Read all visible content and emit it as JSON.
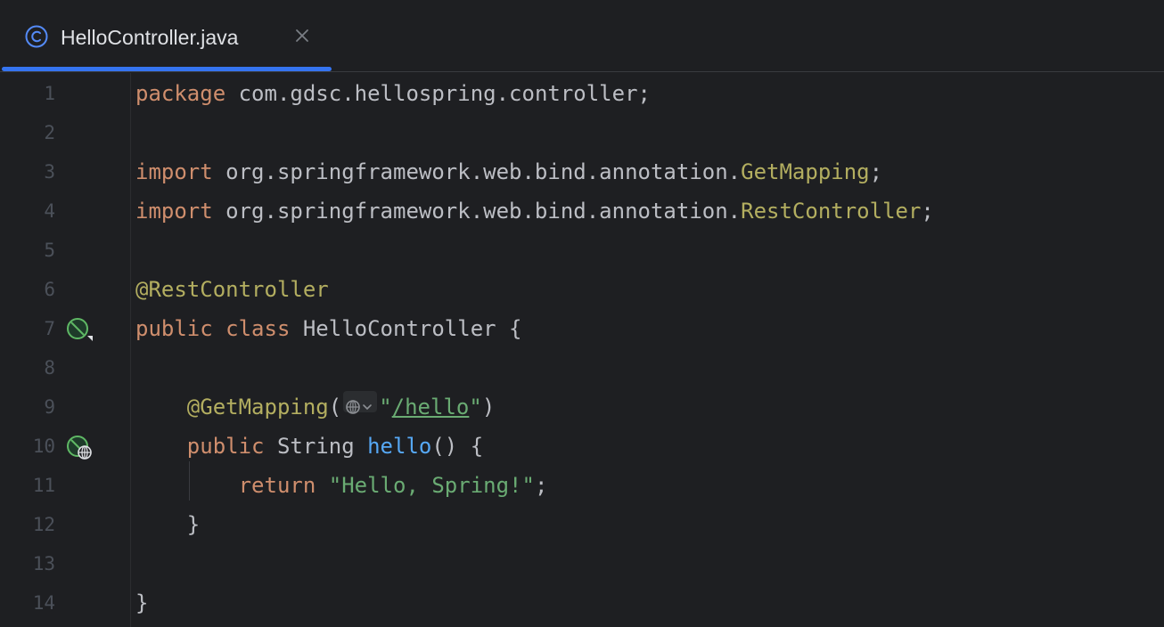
{
  "tab": {
    "title": "HelloController.java",
    "icon": "java-class-icon",
    "close_icon": "close-icon",
    "accent": "#3574f0"
  },
  "editor": {
    "lines": [
      {
        "num": "1",
        "tokens": [
          {
            "t": "package",
            "c": "kw"
          },
          {
            "t": " com.gdsc.hellospring.controller;",
            "c": "plain"
          }
        ]
      },
      {
        "num": "2",
        "tokens": []
      },
      {
        "num": "3",
        "tokens": [
          {
            "t": "import",
            "c": "kw"
          },
          {
            "t": " org.springframework.web.bind.annotation.",
            "c": "plain"
          },
          {
            "t": "GetMapping",
            "c": "ann"
          },
          {
            "t": ";",
            "c": "plain"
          }
        ]
      },
      {
        "num": "4",
        "tokens": [
          {
            "t": "import",
            "c": "kw"
          },
          {
            "t": " org.springframework.web.bind.annotation.",
            "c": "plain"
          },
          {
            "t": "RestController",
            "c": "ann"
          },
          {
            "t": ";",
            "c": "plain"
          }
        ]
      },
      {
        "num": "5",
        "tokens": []
      },
      {
        "num": "6",
        "tokens": [
          {
            "t": "@RestController",
            "c": "ann"
          }
        ]
      },
      {
        "num": "7",
        "tokens": [
          {
            "t": "public",
            "c": "kw"
          },
          {
            "t": " ",
            "c": "plain"
          },
          {
            "t": "class",
            "c": "kw"
          },
          {
            "t": " HelloController {",
            "c": "plain"
          }
        ],
        "gutter_icon": "spring-bean-icon"
      },
      {
        "num": "8",
        "tokens": []
      },
      {
        "num": "9",
        "tokens": [
          {
            "t": "    ",
            "c": "plain"
          },
          {
            "t": "@GetMapping",
            "c": "ann"
          },
          {
            "t": "(",
            "c": "plain"
          },
          {
            "t": "",
            "c": "inlay"
          },
          {
            "t": "\"",
            "c": "str"
          },
          {
            "t": "/hello",
            "c": "url"
          },
          {
            "t": "\"",
            "c": "str"
          },
          {
            "t": ")",
            "c": "plain"
          }
        ]
      },
      {
        "num": "10",
        "tokens": [
          {
            "t": "    ",
            "c": "plain"
          },
          {
            "t": "public",
            "c": "kw"
          },
          {
            "t": " String ",
            "c": "plain"
          },
          {
            "t": "hello",
            "c": "fn"
          },
          {
            "t": "() {",
            "c": "plain"
          }
        ],
        "gutter_icon": "spring-web-endpoint-icon"
      },
      {
        "num": "11",
        "tokens": [
          {
            "t": "        ",
            "c": "plain"
          },
          {
            "t": "return",
            "c": "kw"
          },
          {
            "t": " ",
            "c": "plain"
          },
          {
            "t": "\"Hello, Spring!\"",
            "c": "str"
          },
          {
            "t": ";",
            "c": "plain"
          }
        ]
      },
      {
        "num": "12",
        "tokens": [
          {
            "t": "    }",
            "c": "plain"
          }
        ]
      },
      {
        "num": "13",
        "tokens": []
      },
      {
        "num": "14",
        "tokens": [
          {
            "t": "}",
            "c": "plain"
          }
        ]
      }
    ],
    "inlay_icon": "globe-dropdown-icon",
    "colors": {
      "background": "#1e1f22",
      "keyword": "#cf8e6d",
      "annotation": "#b3ae60",
      "string": "#6aab73",
      "function": "#56a8f5",
      "text": "#bcbec4",
      "line_number": "#4b5059"
    }
  }
}
